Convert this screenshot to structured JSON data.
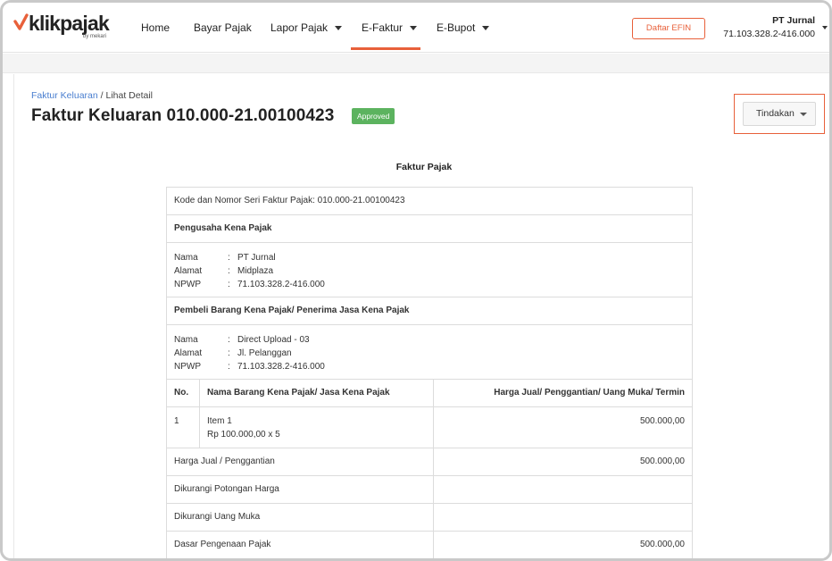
{
  "brand": {
    "name": "klikpajak",
    "sub": "by mekari",
    "accent_color": "#e8603a",
    "badge_color": "#5cb35f",
    "link_color": "#4a7fd0"
  },
  "nav": {
    "items": [
      {
        "label": "Home",
        "has_caret": false
      },
      {
        "label": "Bayar Pajak",
        "has_caret": false
      },
      {
        "label": "Lapor Pajak",
        "has_caret": true
      },
      {
        "label": "E-Faktur",
        "has_caret": true,
        "active": true
      },
      {
        "label": "E-Bupot",
        "has_caret": true
      }
    ],
    "efin_button": "Daftar EFIN",
    "company_name": "PT Jurnal",
    "company_npwp": "71.103.328.2-416.000"
  },
  "breadcrumb": {
    "link": "Faktur Keluaran",
    "separator": " / ",
    "current": "Lihat Detail"
  },
  "page": {
    "title": "Faktur Keluaran 010.000-21.00100423",
    "status": "Approved",
    "action_button": "Tindakan"
  },
  "document": {
    "title": "Faktur Pajak",
    "serial_line": "Kode dan Nomor Seri Faktur Pajak: 010.000-21.00100423",
    "seller_heading": "Pengusaha Kena Pajak",
    "seller": {
      "name_label": "Nama",
      "name": "PT Jurnal",
      "address_label": "Alamat",
      "address": "Midplaza",
      "npwp_label": "NPWP",
      "npwp": "71.103.328.2-416.000"
    },
    "buyer_heading": "Pembeli Barang Kena Pajak/ Penerima Jasa Kena Pajak",
    "buyer": {
      "name_label": "Nama",
      "name": "Direct Upload - 03",
      "address_label": "Alamat",
      "address": "Jl. Pelanggan",
      "npwp_label": "NPWP",
      "npwp": "71.103.328.2-416.000"
    },
    "sep": ":",
    "columns": {
      "no": "No.",
      "item": "Nama Barang Kena Pajak/ Jasa Kena Pajak",
      "price": "Harga Jual/ Penggantian/ Uang Muka/ Termin"
    },
    "items": [
      {
        "no": "1",
        "name": "Item 1",
        "detail": "Rp 100.000,00 x 5",
        "price": "500.000,00"
      }
    ],
    "summary": [
      {
        "label": "Harga Jual / Penggantian",
        "value": "500.000,00"
      },
      {
        "label": "Dikurangi Potongan Harga",
        "value": ""
      },
      {
        "label": "Dikurangi Uang Muka",
        "value": ""
      },
      {
        "label": "Dasar Pengenaan Pajak",
        "value": "500.000,00"
      }
    ]
  }
}
